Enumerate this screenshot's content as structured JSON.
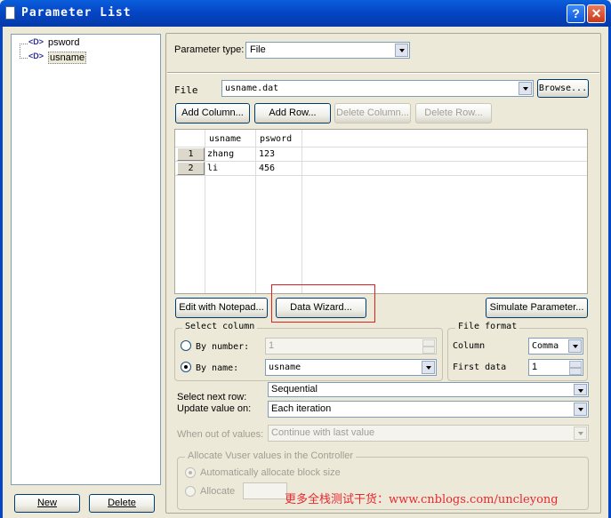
{
  "window": {
    "title": "Parameter List",
    "help_btn": "?",
    "close_btn": "✕"
  },
  "tree": {
    "items": [
      {
        "label": "psword"
      },
      {
        "label": "usname"
      }
    ]
  },
  "left_buttons": {
    "new_label": "New",
    "delete_label": "Delete"
  },
  "param_type": {
    "label": "Parameter type:",
    "value": "File"
  },
  "file": {
    "label": "File",
    "value": "usname.dat",
    "browse_label": "Browse..."
  },
  "grid_buttons": {
    "add_column": "Add Column...",
    "add_row": "Add Row...",
    "delete_column": "Delete Column...",
    "delete_row": "Delete Row..."
  },
  "grid": {
    "columns": [
      "usname",
      "psword"
    ],
    "rows": [
      {
        "num": "1",
        "usname": "zhang",
        "psword": "123"
      },
      {
        "num": "2",
        "usname": "li",
        "psword": "456"
      }
    ]
  },
  "actions": {
    "edit_notepad": "Edit with Notepad...",
    "data_wizard": "Data Wizard...",
    "simulate": "Simulate Parameter..."
  },
  "select_column": {
    "legend": "Select column",
    "by_number_label": "By number:",
    "by_number_value": "1",
    "by_name_label": "By name:",
    "by_name_value": "usname"
  },
  "file_format": {
    "legend": "File format",
    "column_label": "Column",
    "column_value": "Comma",
    "first_data_label": "First data",
    "first_data_value": "1"
  },
  "select_next_row": {
    "label": "Select next row:",
    "value": "Sequential"
  },
  "update_value": {
    "label": "Update value on:",
    "value": "Each iteration"
  },
  "out_of_values": {
    "label": "When out of values:",
    "value": "Continue with last value"
  },
  "allocate": {
    "legend": "Allocate Vuser values in the Controller",
    "auto_label": "Automatically allocate block size",
    "allocate_label": "Allocate"
  },
  "watermark": {
    "text": "更多全栈测试干货：www.cnblogs.com/uncleyong"
  },
  "colors": {
    "titlebar": "#0546c6",
    "close_button": "#d9482e",
    "highlight_box": "#e02020",
    "watermark": "#e8282e"
  }
}
